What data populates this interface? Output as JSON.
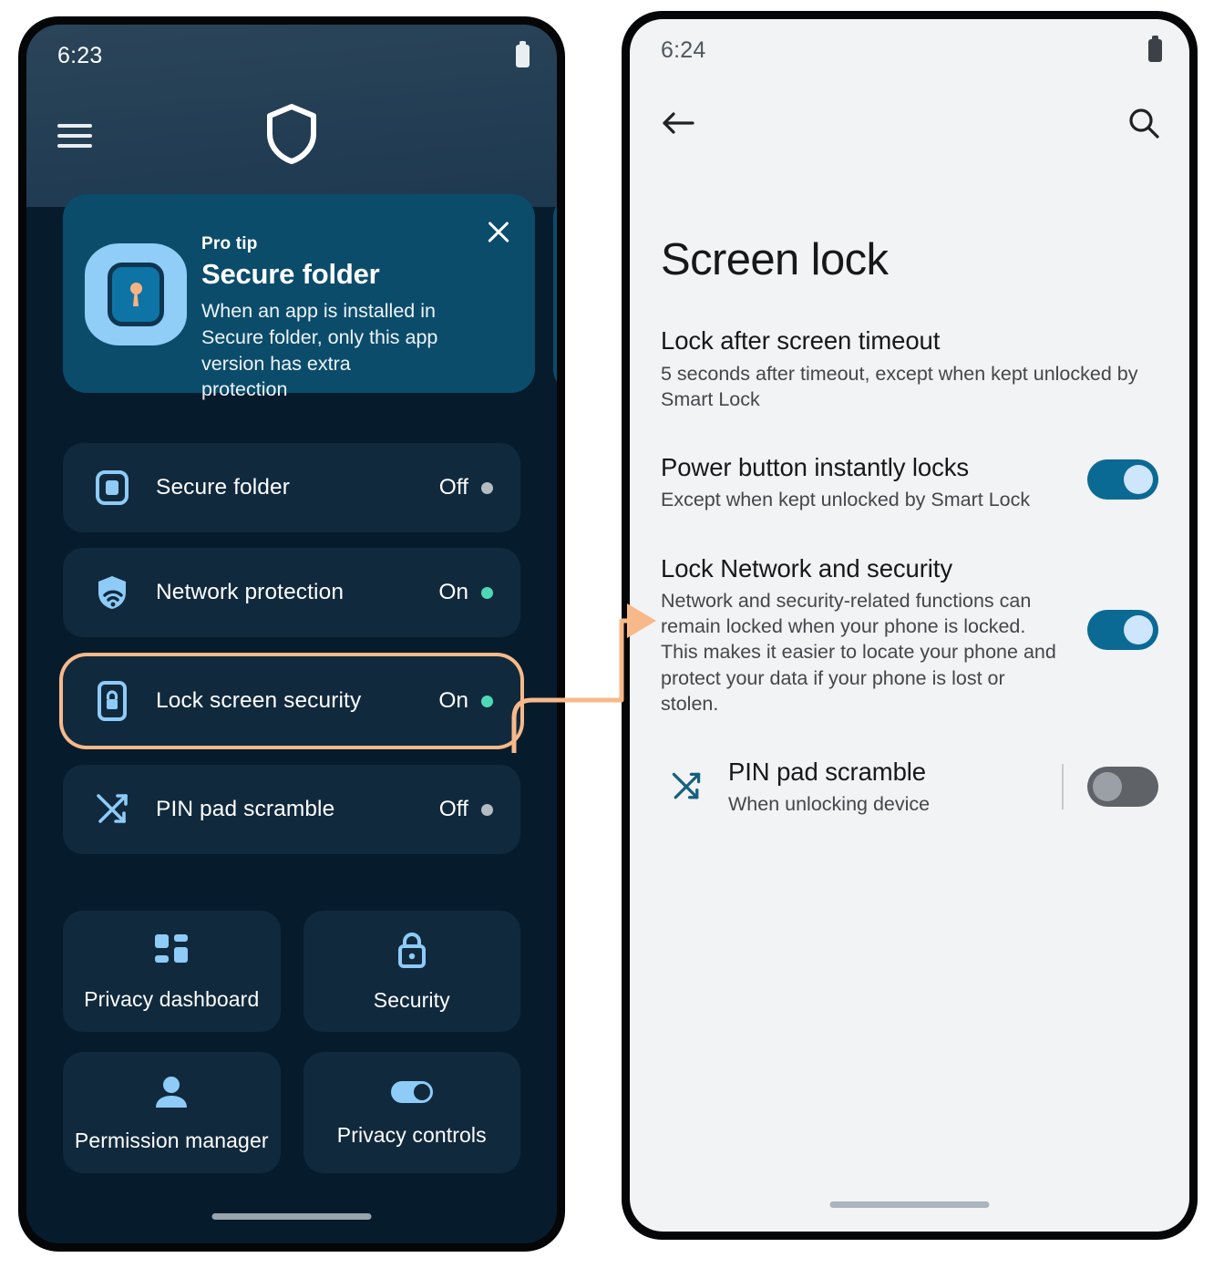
{
  "colors": {
    "accent_highlight": "#f8b98a",
    "dot_on": "#4fd8b6",
    "dot_off": "#b4bcc2",
    "toggle_on_track": "#0b6a93",
    "toggle_on_knob": "#cde6fb",
    "toggle_off_track": "#5f6368",
    "dark_bg": "#061c2d",
    "card_bg": "#10293d",
    "tip_bg": "#0b4c6b",
    "light_bg": "#f1f3f4"
  },
  "left_phone": {
    "status_bar": {
      "time": "6:23",
      "battery_icon": "battery-icon"
    },
    "topbar": {
      "menu_icon": "hamburger-menu-icon",
      "logo_icon": "shield-logo-icon"
    },
    "pro_tip": {
      "eyebrow": "Pro tip",
      "title": "Secure folder",
      "description": "When an app is installed in Secure folder, only this app version has extra protection",
      "icon": "secure-folder-app-icon",
      "close_icon": "close-icon"
    },
    "status_rows": [
      {
        "icon": "secure-folder-icon",
        "label": "Secure folder",
        "value": "Off",
        "state": "off",
        "highlighted": false
      },
      {
        "icon": "network-protection-icon",
        "label": "Network protection",
        "value": "On",
        "state": "on",
        "highlighted": false
      },
      {
        "icon": "lock-screen-icon",
        "label": "Lock screen security",
        "value": "On",
        "state": "on",
        "highlighted": true
      },
      {
        "icon": "shuffle-icon",
        "label": "PIN pad scramble",
        "value": "Off",
        "state": "off",
        "highlighted": false
      }
    ],
    "tiles": [
      {
        "icon": "dashboard-icon",
        "label": "Privacy dashboard"
      },
      {
        "icon": "lock-icon",
        "label": "Security"
      },
      {
        "icon": "person-icon",
        "label": "Permission manager"
      },
      {
        "icon": "toggle-icon",
        "label": "Privacy controls"
      }
    ]
  },
  "right_phone": {
    "status_bar": {
      "time": "6:24",
      "battery_icon": "battery-icon"
    },
    "topbar": {
      "back_icon": "back-arrow-icon",
      "search_icon": "search-icon"
    },
    "page_title": "Screen lock",
    "settings": [
      {
        "title": "Lock after screen timeout",
        "subtitle": "5 seconds after timeout, except when kept unlocked by Smart Lock",
        "has_toggle": false
      },
      {
        "title": "Power button instantly locks",
        "subtitle": "Except when kept unlocked by Smart Lock",
        "has_toggle": true,
        "toggle_state": "on"
      },
      {
        "title": "Lock Network and security",
        "subtitle": "Network and security-related functions can remain locked when your phone is locked. This makes it easier to locate your phone and protect your data if your phone is lost or stolen.",
        "has_toggle": true,
        "toggle_state": "on"
      }
    ],
    "indented_setting": {
      "icon": "shuffle-icon",
      "title": "PIN pad scramble",
      "subtitle": "When unlocking device",
      "toggle_state": "off"
    }
  },
  "connector": {
    "name": "flow-arrow",
    "color": "#f8b98a"
  }
}
